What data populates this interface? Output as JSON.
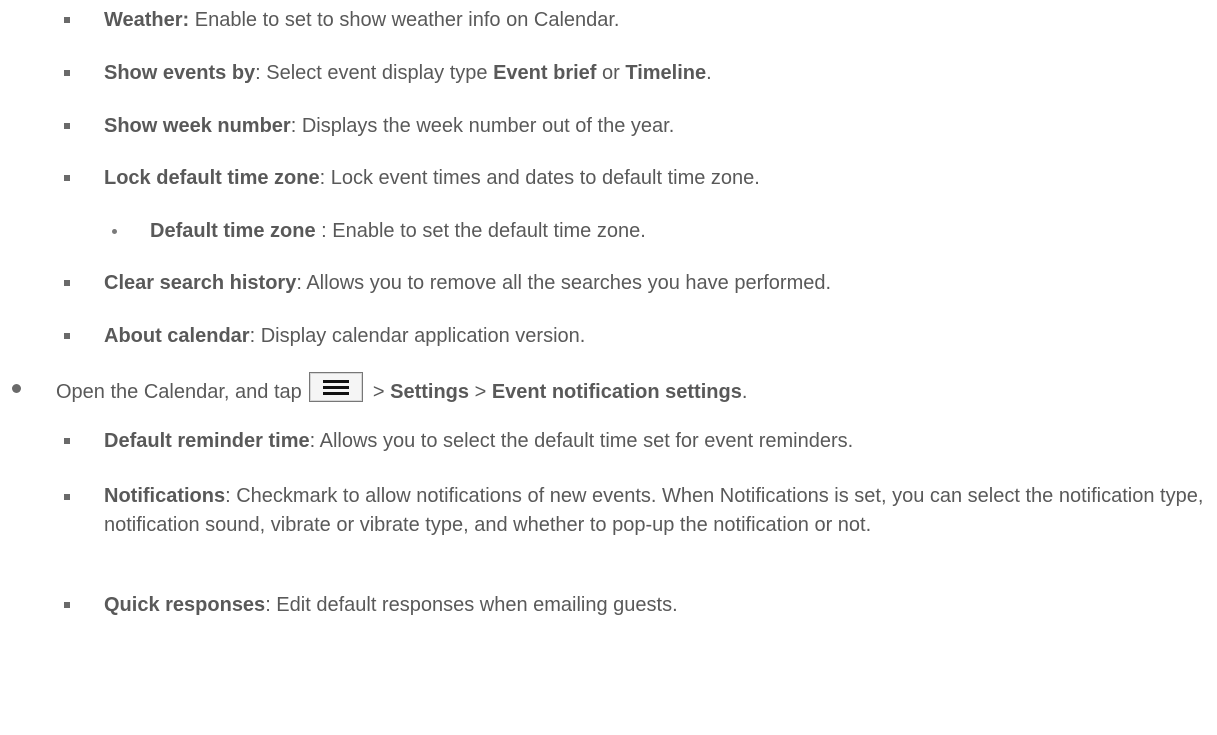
{
  "calendar_settings": {
    "weather": {
      "term": "Weather:",
      "desc": " Enable to set to show weather info on Calendar."
    },
    "show_events_by": {
      "term": "Show events by",
      "desc_a": ": Select event display type ",
      "opt1": "Event brief",
      "or": " or ",
      "opt2": "Timeline",
      "end": "."
    },
    "show_week_number": {
      "term": "Show week number",
      "desc": ": Displays the week number out of the year."
    },
    "lock_time_zone": {
      "term": "Lock default time zone",
      "desc": ": Lock event times and dates to default time zone."
    },
    "default_time_zone": {
      "term": "Default time zone",
      "desc": " : Enable to set the default time zone."
    },
    "clear_search": {
      "term": "Clear search history",
      "desc": ": Allows you to remove all the searches you have performed."
    },
    "about": {
      "term": "About calendar",
      "desc": ": Display calendar application version."
    }
  },
  "notification_step": {
    "text_a": "Open the Calendar, and tap ",
    "menu_icon": "menu-icon",
    "gt1": " > ",
    "settings": "Settings",
    "gt2": " > ",
    "event_notification": "Event notification settings",
    "end": "."
  },
  "notification_settings": {
    "default_reminder": {
      "term": "Default reminder time",
      "desc": ": Allows you to select the default time set for event reminders."
    },
    "notifications": {
      "term": "Notifications",
      "desc": ": Checkmark to allow notifications of new events. When Notifications is set, you can select the notification type, notification sound, vibrate or vibrate type, and whether to pop-up the notification or not."
    },
    "quick_responses": {
      "term": "Quick responses",
      "desc": ": Edit default responses when emailing guests."
    }
  },
  "colors": {
    "text": "#595959",
    "bullet": "#6a6a6a"
  }
}
